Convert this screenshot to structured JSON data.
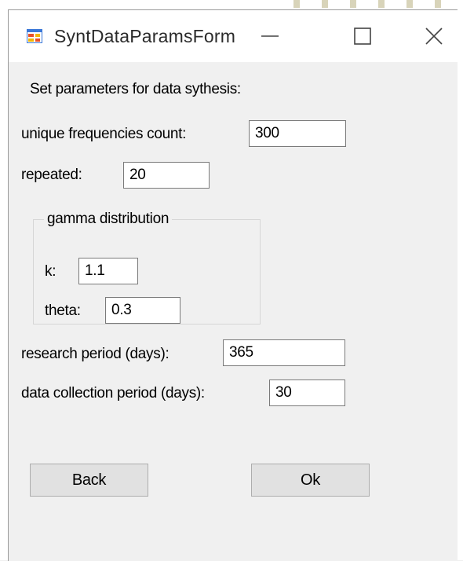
{
  "window": {
    "title": "SyntDataParamsForm",
    "controls": {
      "minimize_glyph": "—",
      "maximize_glyph": "☐",
      "close_glyph": "✕"
    }
  },
  "form": {
    "heading": "Set parameters for data sythesis:",
    "unique_frequencies": {
      "label": "unique frequencies count:",
      "value": "300"
    },
    "repeated": {
      "label": "repeated:",
      "value": "20"
    },
    "gamma_group": {
      "legend": "gamma distribution",
      "k": {
        "label": "k:",
        "value": "1.1"
      },
      "theta": {
        "label": "theta:",
        "value": "0.3"
      }
    },
    "research_period": {
      "label": "research period (days):",
      "value": "365"
    },
    "collection_period": {
      "label": "data collection period (days):",
      "value": "30"
    }
  },
  "buttons": {
    "back": "Back",
    "ok": "Ok"
  },
  "icons": {
    "app": "winforms-app-icon"
  },
  "colors": {
    "titlebar": "#ffffff",
    "window_bg": "#f0f0f0",
    "button_bg": "#e1e1e1",
    "field_border": "#7a7a7a"
  }
}
